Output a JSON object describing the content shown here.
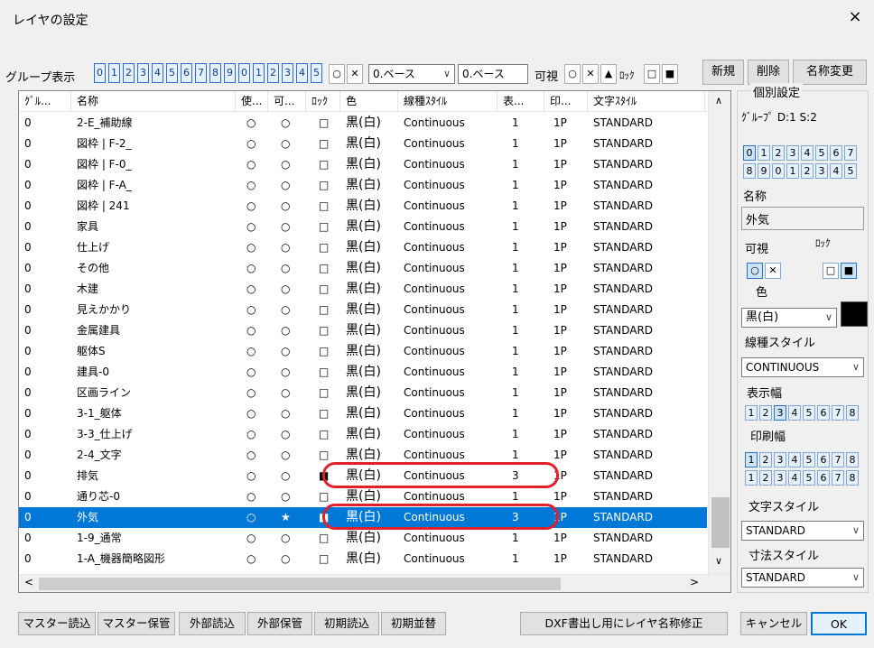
{
  "window": {
    "title": "レイヤの設定",
    "close_glyph": "×"
  },
  "toolbar": {
    "group_label": "グループ表示",
    "group_digits": [
      "0",
      "1",
      "2",
      "3",
      "4",
      "5",
      "6",
      "7",
      "8",
      "9",
      "0",
      "1",
      "2",
      "3",
      "4",
      "5"
    ],
    "sym_circle": "○",
    "sym_cross": "✕",
    "base_select_1": "0.ベース",
    "base_select_2": "0.ベース",
    "visible_label": "可視",
    "vis_circle": "○",
    "vis_cross": "✕",
    "vis_tri": "▲",
    "lock_label": "ﾛｯｸ",
    "lock_open": "□",
    "lock_closed": "■",
    "new_label": "新規",
    "delete_label": "削除",
    "rename_label": "名称変更"
  },
  "table": {
    "columns": [
      "ｸﾞﾙ...",
      "名称",
      "使...",
      "可...",
      "ﾛｯｸ",
      "色",
      "線種ｽﾀｲﾙ",
      "表...",
      "印...",
      "文字ｽﾀｲﾙ"
    ],
    "rows": [
      {
        "group": "0",
        "name": "2-E_補助線",
        "use": "○",
        "vis": "○",
        "lock": "□",
        "color": "黒(白)",
        "ltype": "Continuous",
        "disp": "1",
        "print": "1P",
        "tstyle": "STANDARD"
      },
      {
        "group": "0",
        "name": "図枠 | F-2_",
        "use": "○",
        "vis": "○",
        "lock": "□",
        "color": "黒(白)",
        "ltype": "Continuous",
        "disp": "1",
        "print": "1P",
        "tstyle": "STANDARD"
      },
      {
        "group": "0",
        "name": "図枠 | F-0_",
        "use": "○",
        "vis": "○",
        "lock": "□",
        "color": "黒(白)",
        "ltype": "Continuous",
        "disp": "1",
        "print": "1P",
        "tstyle": "STANDARD"
      },
      {
        "group": "0",
        "name": "図枠 | F-A_",
        "use": "○",
        "vis": "○",
        "lock": "□",
        "color": "黒(白)",
        "ltype": "Continuous",
        "disp": "1",
        "print": "1P",
        "tstyle": "STANDARD"
      },
      {
        "group": "0",
        "name": "図枠 | 241",
        "use": "○",
        "vis": "○",
        "lock": "□",
        "color": "黒(白)",
        "ltype": "Continuous",
        "disp": "1",
        "print": "1P",
        "tstyle": "STANDARD"
      },
      {
        "group": "0",
        "name": "家具",
        "use": "○",
        "vis": "○",
        "lock": "□",
        "color": "黒(白)",
        "ltype": "Continuous",
        "disp": "1",
        "print": "1P",
        "tstyle": "STANDARD"
      },
      {
        "group": "0",
        "name": "仕上げ",
        "use": "○",
        "vis": "○",
        "lock": "□",
        "color": "黒(白)",
        "ltype": "Continuous",
        "disp": "1",
        "print": "1P",
        "tstyle": "STANDARD"
      },
      {
        "group": "0",
        "name": "その他",
        "use": "○",
        "vis": "○",
        "lock": "□",
        "color": "黒(白)",
        "ltype": "Continuous",
        "disp": "1",
        "print": "1P",
        "tstyle": "STANDARD"
      },
      {
        "group": "0",
        "name": "木建",
        "use": "○",
        "vis": "○",
        "lock": "□",
        "color": "黒(白)",
        "ltype": "Continuous",
        "disp": "1",
        "print": "1P",
        "tstyle": "STANDARD"
      },
      {
        "group": "0",
        "name": "見えかかり",
        "use": "○",
        "vis": "○",
        "lock": "□",
        "color": "黒(白)",
        "ltype": "Continuous",
        "disp": "1",
        "print": "1P",
        "tstyle": "STANDARD"
      },
      {
        "group": "0",
        "name": "金属建具",
        "use": "○",
        "vis": "○",
        "lock": "□",
        "color": "黒(白)",
        "ltype": "Continuous",
        "disp": "1",
        "print": "1P",
        "tstyle": "STANDARD"
      },
      {
        "group": "0",
        "name": "躯体S",
        "use": "○",
        "vis": "○",
        "lock": "□",
        "color": "黒(白)",
        "ltype": "Continuous",
        "disp": "1",
        "print": "1P",
        "tstyle": "STANDARD"
      },
      {
        "group": "0",
        "name": "建具-0",
        "use": "○",
        "vis": "○",
        "lock": "□",
        "color": "黒(白)",
        "ltype": "Continuous",
        "disp": "1",
        "print": "1P",
        "tstyle": "STANDARD"
      },
      {
        "group": "0",
        "name": "区画ライン",
        "use": "○",
        "vis": "○",
        "lock": "□",
        "color": "黒(白)",
        "ltype": "Continuous",
        "disp": "1",
        "print": "1P",
        "tstyle": "STANDARD"
      },
      {
        "group": "0",
        "name": "3-1_躯体",
        "use": "○",
        "vis": "○",
        "lock": "□",
        "color": "黒(白)",
        "ltype": "Continuous",
        "disp": "1",
        "print": "1P",
        "tstyle": "STANDARD"
      },
      {
        "group": "0",
        "name": "3-3_仕上げ",
        "use": "○",
        "vis": "○",
        "lock": "□",
        "color": "黒(白)",
        "ltype": "Continuous",
        "disp": "1",
        "print": "1P",
        "tstyle": "STANDARD"
      },
      {
        "group": "0",
        "name": "2-4_文字",
        "use": "○",
        "vis": "○",
        "lock": "□",
        "color": "黒(白)",
        "ltype": "Continuous",
        "disp": "1",
        "print": "1P",
        "tstyle": "STANDARD"
      },
      {
        "group": "0",
        "name": "排気",
        "use": "○",
        "vis": "○",
        "lock": "■",
        "color": "黒(白)",
        "ltype": "Continuous",
        "disp": "3",
        "print": "1P",
        "tstyle": "STANDARD",
        "highlighted": true
      },
      {
        "group": "0",
        "name": "通り芯-0",
        "use": "○",
        "vis": "○",
        "lock": "□",
        "color": "黒(白)",
        "ltype": "Continuous",
        "disp": "1",
        "print": "1P",
        "tstyle": "STANDARD"
      },
      {
        "group": "0",
        "name": "外気",
        "use": "○",
        "vis": "★",
        "lock": "■",
        "color": "黒(白)",
        "ltype": "Continuous",
        "disp": "3",
        "print": "1P",
        "tstyle": "STANDARD",
        "selected": true,
        "highlighted": true
      },
      {
        "group": "0",
        "name": "1-9_通常",
        "use": "○",
        "vis": "○",
        "lock": "□",
        "color": "黒(白)",
        "ltype": "Continuous",
        "disp": "1",
        "print": "1P",
        "tstyle": "STANDARD"
      },
      {
        "group": "0",
        "name": "1-A_機器簡略図形",
        "use": "○",
        "vis": "○",
        "lock": "□",
        "color": "黒(白)",
        "ltype": "Continuous",
        "disp": "1",
        "print": "1P",
        "tstyle": "STANDARD"
      }
    ],
    "scroll_up": "∧",
    "scroll_down": "∨",
    "scroll_left": "<",
    "scroll_right": ">"
  },
  "panel": {
    "title": "個別設定",
    "group_info": "ｸﾞﾙｰﾌﾟ D:1 S:2",
    "digits_row1": [
      "0",
      "1",
      "2",
      "3",
      "4",
      "5",
      "6",
      "7"
    ],
    "digits_row2": [
      "8",
      "9",
      "0",
      "1",
      "2",
      "3",
      "4",
      "5"
    ],
    "name_label": "名称",
    "name_value": "外気",
    "visible_label": "可視",
    "lock_label": "ﾛｯｸ",
    "vis_on": "○",
    "vis_off": "✕",
    "lock_off": "□",
    "lock_on": "■",
    "color_label": "色",
    "color_value": "黒(白)",
    "swatch_color": "#000000",
    "ltype_label": "線種スタイル",
    "ltype_value": "CONTINUOUS",
    "disp_label": "表示幅",
    "disp_widths": [
      "1",
      "2",
      "3",
      "4",
      "5",
      "6",
      "7",
      "8"
    ],
    "print_label": "印刷幅",
    "print_row1": [
      "1",
      "2",
      "3",
      "4",
      "5",
      "6",
      "7",
      "8"
    ],
    "print_row2": [
      "1",
      "2",
      "3",
      "4",
      "5",
      "6",
      "7",
      "8"
    ],
    "text_label": "文字スタイル",
    "text_value": "STANDARD",
    "dim_label": "寸法スタイル",
    "dim_value": "STANDARD",
    "chev": "∨"
  },
  "footer": {
    "master_load": "マスター読込",
    "master_save": "マスター保管",
    "ext_load": "外部読込",
    "ext_save": "外部保管",
    "init_load": "初期読込",
    "init_sort": "初期並替",
    "dxf_fix": "DXF書出し用にレイヤ名称修正",
    "cancel": "キャンセル",
    "ok": "OK"
  },
  "colors": {
    "accent": "#0078d7",
    "highlight_oval": "#e0202b"
  }
}
